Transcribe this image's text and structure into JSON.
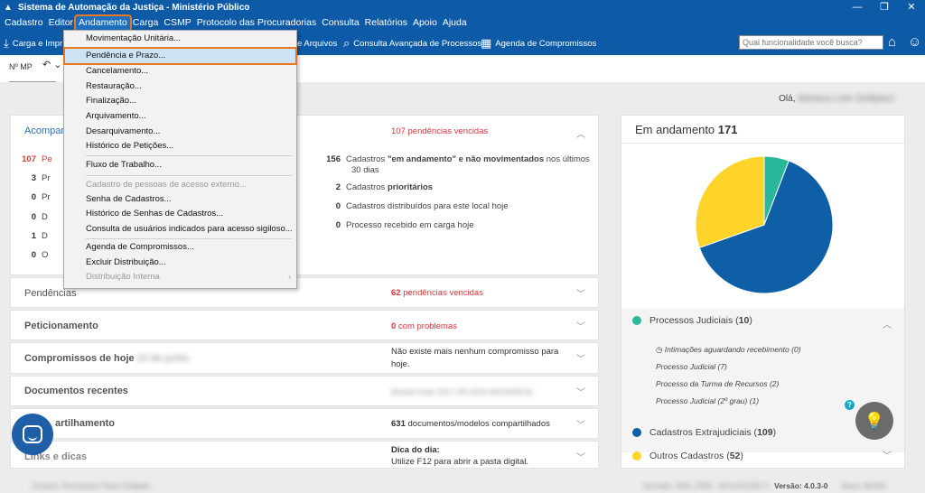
{
  "window": {
    "title": "Sistema de Automação da Justiça - Ministério Público",
    "controls": [
      "—",
      "❐",
      "✕"
    ]
  },
  "menubar": [
    "Cadastro",
    "Editor",
    "Andamento",
    "Carga",
    "CSMP",
    "Protocolo das Procuradorias",
    "Consulta",
    "Relatórios",
    "Apoio",
    "Ajuda"
  ],
  "toolbar": {
    "carga": "Carga e Impr",
    "arquivos": "e Arquivos",
    "consulta_avancada": "Consulta Avançada de Processos",
    "agenda": "Agenda de Compromissos",
    "search_placeholder": "Qual funcionalidade você busca?"
  },
  "filter": {
    "nmp_label": "Nº MP",
    "undo": "↶ ⌄"
  },
  "greeting": {
    "prefix": "Olá,",
    "user": "Mariana Leite (Softplan)"
  },
  "dropdown": {
    "items": [
      {
        "label": "Movimentação Unitária...",
        "state": "normal"
      },
      {
        "label": "Pendência e Prazo...",
        "state": "highlight"
      },
      {
        "label": "Cancelamento...",
        "state": "normal"
      },
      {
        "label": "Restauração...",
        "state": "normal"
      },
      {
        "label": "Finalização...",
        "state": "normal"
      },
      {
        "label": "Arquivamento...",
        "state": "normal"
      },
      {
        "label": "Desarquivamento...",
        "state": "normal"
      },
      {
        "label": "Histórico de Petições...",
        "state": "normal"
      },
      {
        "label": "Fluxo de Trabalho...",
        "state": "normal"
      },
      {
        "label": "Cadastro de pessoas de acesso externo...",
        "state": "disabled"
      },
      {
        "label": "Senha de Cadastros...",
        "state": "normal"
      },
      {
        "label": "Histórico de Senhas de Cadastros...",
        "state": "normal"
      },
      {
        "label": "Consulta de usuários indicados para acesso sigiloso...",
        "state": "normal"
      },
      {
        "label": "Agenda de Compromissos...",
        "state": "normal"
      },
      {
        "label": "Excluir Distribuição...",
        "state": "normal"
      },
      {
        "label": "Distribuição Interna",
        "state": "disabled"
      }
    ]
  },
  "acompanhamento": {
    "title": "Acompan",
    "status_count": "107",
    "status_text": "pendências vencidas",
    "left_rows": [
      {
        "num": "107",
        "text": "Pe"
      },
      {
        "num": "3",
        "text": "Pr"
      },
      {
        "num": "0",
        "text": "Pr"
      },
      {
        "num": "0",
        "text": "D"
      },
      {
        "num": "1",
        "text": "D"
      },
      {
        "num": "0",
        "text": "O"
      }
    ],
    "right_rows": [
      {
        "num": "156",
        "text_pre": "Cadastros ",
        "text_bold": "\"em andamento\" e não movimentados",
        "text_post": " nos últimos",
        "line2": "30 dias"
      },
      {
        "num": "2",
        "text_pre": "Cadastros ",
        "text_bold": "prioritários",
        "text_post": "",
        "line2": ""
      },
      {
        "num": "0",
        "text_pre": "Cadastros distribuídos para este local hoje",
        "text_bold": "",
        "text_post": "",
        "line2": ""
      },
      {
        "num": "0",
        "text_pre": "Processo recebido em carga hoje",
        "text_bold": "",
        "text_post": "",
        "line2": ""
      }
    ]
  },
  "panels": {
    "pendencias": {
      "title": "Pendências",
      "count": "62",
      "text": "pendências vencidas"
    },
    "peticionamento": {
      "title": "Peticionamento",
      "count": "0",
      "text": "com problemas"
    },
    "compromissos": {
      "title": "Compromissos de hoje",
      "date_blur": "10 de junho",
      "text1": "Não existe mais nenhum compromisso para",
      "text2": "hoje."
    },
    "documentos": {
      "title": "Documentos recentes",
      "blur": "Modelo teste 2017 (00.2020.00016059-8)"
    },
    "compartilhamento": {
      "title": "artilhamento",
      "count": "631",
      "text": "documentos/modelos compartilhados"
    },
    "links": {
      "title": "Links e dicas",
      "tip_title": "Dica do dia:",
      "tip_text": "Utilize F12 para abrir a pasta digital."
    }
  },
  "card": {
    "title_prefix": "Em andamento",
    "title_count": "171",
    "legend": [
      {
        "name": "Processos Judiciais",
        "count": "10",
        "color": "#2ab89a"
      },
      {
        "name": "Cadastros Extrajudiciais",
        "count": "109",
        "color": "#0f5fa6"
      },
      {
        "name": "Outros Cadastros",
        "count": "52",
        "color": "#ffd42a"
      }
    ],
    "sub_items": [
      "Intimações aguardando recebimento (0)",
      "Processo Judicial (7)",
      "Processo da Turma de Recursos (2)",
      "Processo Judicial (2º grau) (1)"
    ]
  },
  "chart_data": {
    "type": "pie",
    "categories": [
      "Processos Judiciais",
      "Cadastros Extrajudiciais",
      "Outros Cadastros"
    ],
    "values": [
      10,
      109,
      52
    ],
    "colors": [
      "#2ab89a",
      "#0f5fa6",
      "#ffd42a"
    ]
  },
  "statusbar": {
    "user_blur": "Usuário: Promotoria Teste Softplan",
    "mid_blur": "Servidor: SRV_PRD - APLICAÇÃO 3",
    "version": "Versão: 4.0.3-0",
    "right_blur": "Base: MURA"
  }
}
